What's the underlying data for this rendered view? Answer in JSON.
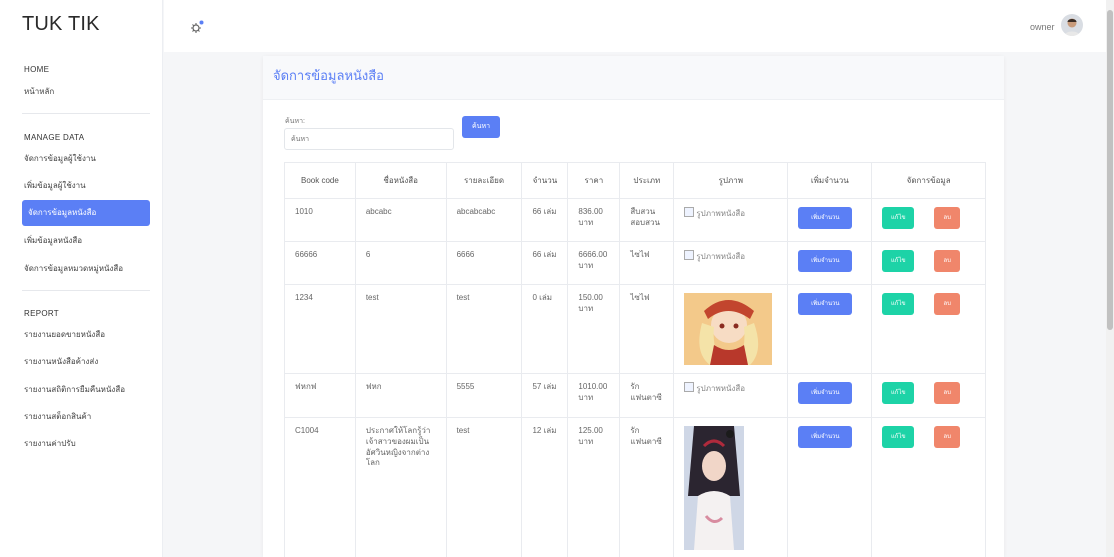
{
  "brand": "TUK TIK",
  "sidebar": {
    "home_head": "HOME",
    "home_items": [
      "หน้าหลัก"
    ],
    "manage_head": "MANAGE DATA",
    "manage_items": [
      "จัดการข้อมูลผู้ใช้งาน",
      "เพิ่มข้อมูลผู้ใช้งาน",
      "จัดการข้อมูลหนังสือ",
      "เพิ่มข้อมูลหนังสือ",
      "จัดการข้อมูลหมวดหมู่หนังสือ"
    ],
    "report_head": "REPORT",
    "report_items": [
      "รายงานยอดขายหนังสือ",
      "รายงานหนังสือค้างส่ง",
      "รายงานสถิติการยืมคืนหนังสือ",
      "รายงานสต็อกสินค้า",
      "รายงานค่าปรับ"
    ]
  },
  "topbar": {
    "user": "owner"
  },
  "card": {
    "title": "จัดการข้อมูลหนังสือ",
    "search_label": "ค้นหา:",
    "search_placeholder": "ค้นหา",
    "search_button": "ค้นหา"
  },
  "table": {
    "headers": [
      "Book code",
      "ชื่อหนังสือ",
      "รายละเอียด",
      "จำนวน",
      "ราคา",
      "ประเภท",
      "รูปภาพ",
      "เพิ่มจำนวน",
      "จัดการข้อมูล"
    ],
    "rows": [
      {
        "code": "1010",
        "name": "abcabc",
        "detail": "abcabcabc",
        "qty": "66 เล่ม",
        "price": "836.00 บาท",
        "type": "สืบสวน สอบสวน",
        "image": "รูปภาพหนังสือ"
      },
      {
        "code": "66666",
        "name": "6",
        "detail": "6666",
        "qty": "66 เล่ม",
        "price": "6666.00 บาท",
        "type": "ไซไฟ",
        "image": "รูปภาพหนังสือ"
      },
      {
        "code": "1234",
        "name": "test",
        "detail": "test",
        "qty": "0 เล่ม",
        "price": "150.00 บาท",
        "type": "ไซไฟ",
        "image": ""
      },
      {
        "code": "ฟหกฟ",
        "name": "ฟหก",
        "detail": "5555",
        "qty": "57 เล่ม",
        "price": "1010.00 บาท",
        "type": "รัก แฟนตาซี",
        "image": "รูปภาพหนังสือ"
      },
      {
        "code": "C1004",
        "name": "ประกาศให้โลกรู้ว่าเจ้าสาวของผมเป็นอัศวินหญิงจากต่างโลก",
        "detail": "test",
        "qty": "12 เล่ม",
        "price": "125.00 บาท",
        "type": "รัก แฟนตาซี",
        "image": ""
      }
    ],
    "add_label": "เพิ่มจำนวน",
    "edit_label": "แก้ไข",
    "delete_label": "ลบ"
  },
  "colors": {
    "accent": "#5b7ff5",
    "edit": "#1dd3a7",
    "delete": "#f0866b"
  }
}
